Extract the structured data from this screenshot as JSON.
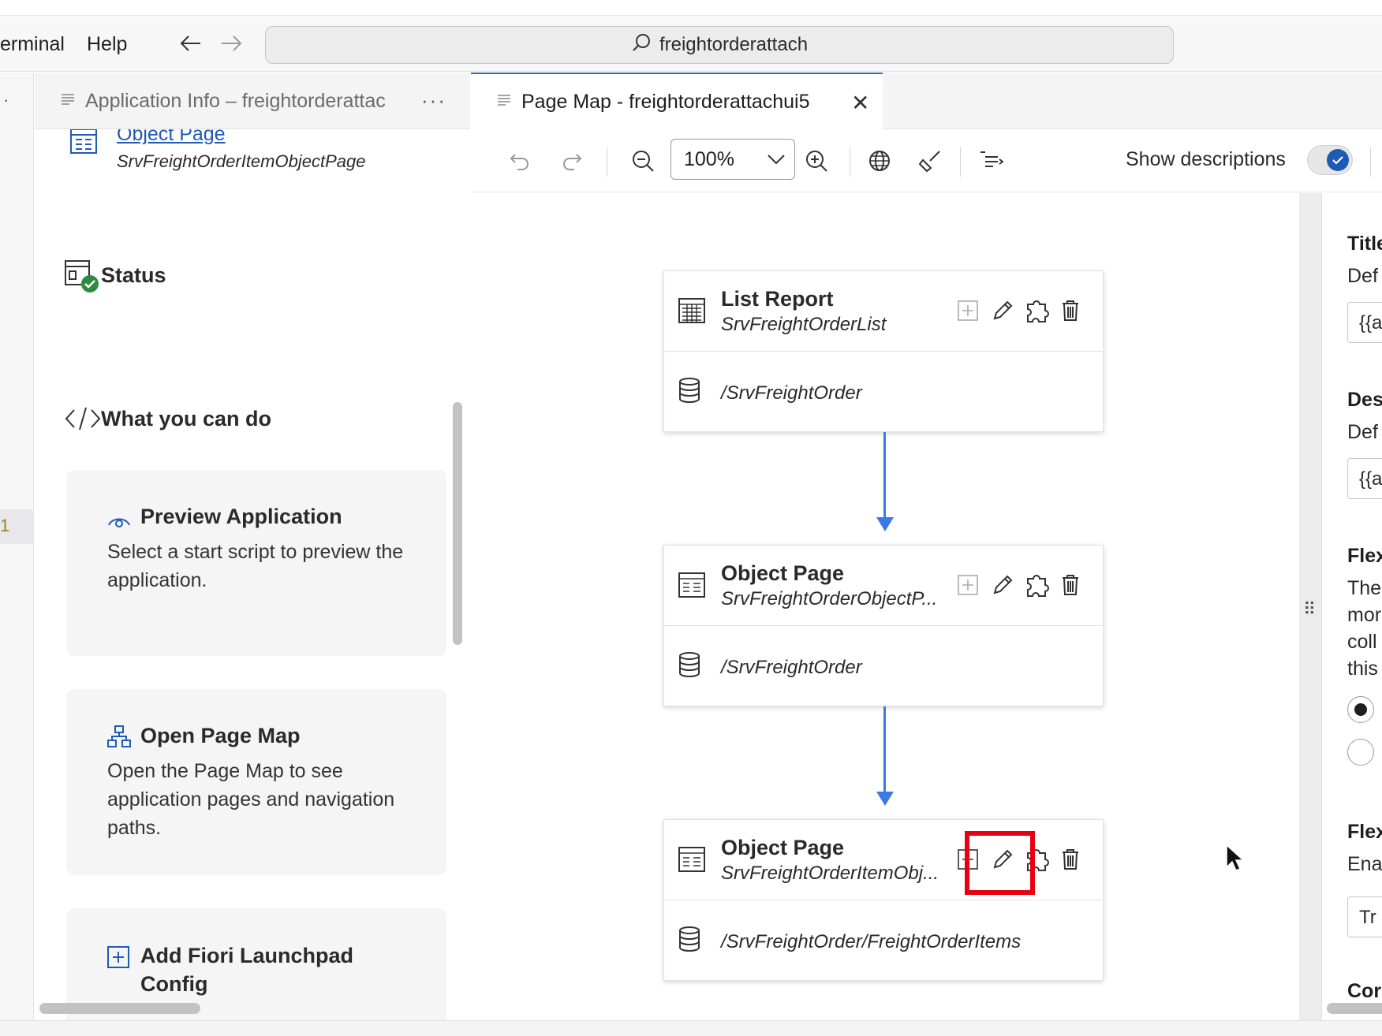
{
  "menubar": {
    "items": [
      "erminal",
      "Help"
    ],
    "search_text": "freightorderattach"
  },
  "activity_bar": {
    "dots": "·",
    "badge": "1"
  },
  "left_panel": {
    "tab_label": "Application Info – freightorderattac",
    "tab_more": "···",
    "object_page_link": "Object Page",
    "object_page_sub": "SrvFreightOrderItemObjectPage",
    "status_title": "Status",
    "what_title": "What you can do",
    "cards": [
      {
        "title": "Preview Application",
        "text": "Select a start script to preview the application."
      },
      {
        "title": "Open Page Map",
        "text": "Open the Page Map to see application pages and navigation paths."
      },
      {
        "title": "Add Fiori Launchpad Config",
        "text": ""
      }
    ]
  },
  "editor": {
    "tab_label": "Page Map - freightorderattachui5",
    "tab_close": "✕",
    "toolbar": {
      "zoom_value": "100%",
      "show_descriptions_label": "Show descriptions",
      "show_descriptions_on": true
    }
  },
  "page_map": {
    "nodes": [
      {
        "title": "List Report",
        "subtitle": "SrvFreightOrderList",
        "entity": "/SrvFreightOrder",
        "icon": "list-report-icon"
      },
      {
        "title": "Object Page",
        "subtitle": "SrvFreightOrderObjectP...",
        "entity": "/SrvFreightOrder",
        "icon": "object-page-icon"
      },
      {
        "title": "Object Page",
        "subtitle": "SrvFreightOrderItemObj...",
        "entity": "/SrvFreightOrder/FreightOrderItems",
        "icon": "object-page-icon"
      }
    ],
    "highlight_color": "#e60012",
    "connector_color": "#3b7ae6"
  },
  "properties": {
    "title_head": "Title",
    "title_desc": "Def",
    "title_value": "{{a",
    "desc_head": "Des",
    "desc_desc": "Def",
    "desc_value": "{{a",
    "flex_head": "Flex",
    "flex_text": [
      "The",
      "mor",
      "coll",
      "this"
    ],
    "flex2_head": "Flex",
    "flex2_desc": "Ena",
    "flex2_value": "Tr",
    "last_head": "Cor"
  },
  "colors": {
    "accent": "#1f5ab5",
    "status_green": "#2e8b3e"
  }
}
